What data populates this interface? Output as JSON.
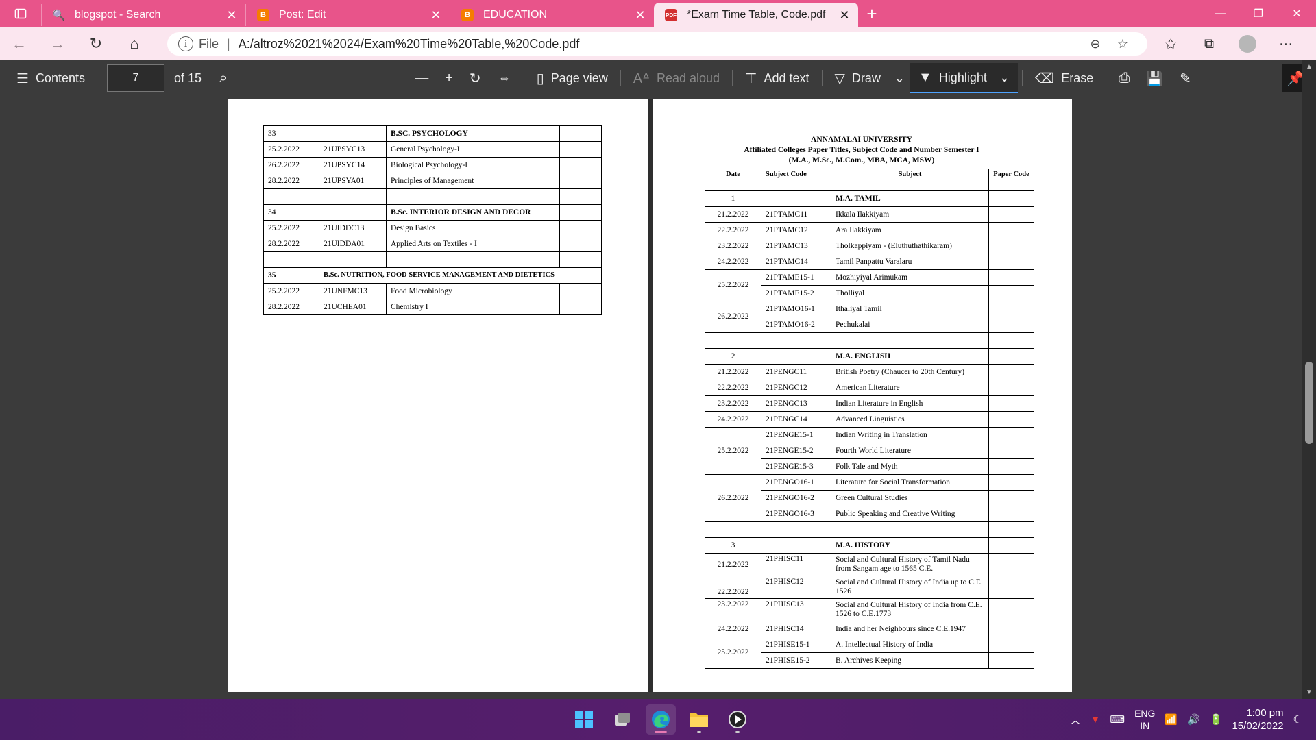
{
  "browser": {
    "tabs": [
      {
        "title": "blogspot - Search",
        "favicon": "search-icon",
        "active": false
      },
      {
        "title": "Post: Edit",
        "favicon": "blogger-icon",
        "active": false
      },
      {
        "title": "EDUCATION",
        "favicon": "blogger-icon",
        "active": false
      },
      {
        "title": "*Exam Time Table, Code.pdf",
        "favicon": "pdf-icon",
        "active": true
      }
    ],
    "address": {
      "scheme": "File",
      "url": "A:/altroz%2021%2024/Exam%20Time%20Table,%20Code.pdf"
    }
  },
  "pdf_toolbar": {
    "contents": "Contents",
    "page_current": "7",
    "page_total": "of 15",
    "page_view": "Page view",
    "read_aloud": "Read aloud",
    "add_text": "Add text",
    "draw": "Draw",
    "highlight": "Highlight",
    "erase": "Erase"
  },
  "left_page": {
    "rows": [
      {
        "num": "33",
        "title": "B.SC. PSYCHOLOGY"
      },
      {
        "date": "25.2.2022",
        "code": "21UPSYC13",
        "subject": "General Psychology-I"
      },
      {
        "date": "26.2.2022",
        "code": "21UPSYC14",
        "subject": "Biological Psychology-I"
      },
      {
        "date": "28.2.2022",
        "code": "21UPSYA01",
        "subject": "Principles of  Management"
      },
      {
        "num": "34",
        "title": "B.Sc.  INTERIOR DESIGN AND DECOR"
      },
      {
        "date": "25.2.2022",
        "code": "21UIDDC13",
        "subject": "Design Basics"
      },
      {
        "date": "28.2.2022",
        "code": "21UIDDA01",
        "subject": "Applied Arts on Textiles - I"
      },
      {
        "num": "35",
        "title": "B.Sc. NUTRITION, FOOD SERVICE MANAGEMENT AND DIETETICS"
      },
      {
        "date": "25.2.2022",
        "code": "21UNFMC13",
        "subject": "Food Microbiology"
      },
      {
        "date": "28.2.2022",
        "code": "21UCHEA01",
        "subject": "Chemistry I"
      }
    ]
  },
  "right_page": {
    "heading_1": "ANNAMALAI UNIVERSITY",
    "heading_2": "Affiliated Colleges Paper Titles, Subject Code  and Number Semester  I",
    "heading_3": "(M.A., M.Sc., M.Com., MBA, MCA, MSW)",
    "columns": [
      "Date",
      "Subject Code",
      "Subject",
      "Paper Code"
    ],
    "tamil": {
      "num": "1",
      "title": "M.A. TAMIL",
      "rows": [
        {
          "date": "21.2.2022",
          "code": "21PTAMC11",
          "subject": "Ikkala Ilakkiyam"
        },
        {
          "date": "22.2.2022",
          "code": "21PTAMC12",
          "subject": "Ara Ilakkiyam"
        },
        {
          "date": "23.2.2022",
          "code": "21PTAMC13",
          "subject": "Tholkappiyam - (Eluthuthathikaram)"
        },
        {
          "date": "24.2.2022",
          "code": "21PTAMC14",
          "subject": "Tamil Panpattu Varalaru"
        }
      ],
      "group_25": {
        "date": "25.2.2022",
        "items": [
          {
            "code": "21PTAME15-1",
            "subject": "Mozhiyiyal Arimukam"
          },
          {
            "code": "21PTAME15-2",
            "subject": "Tholliyal"
          }
        ]
      },
      "group_26": {
        "date": "26.2.2022",
        "items": [
          {
            "code": "21PTAMO16-1",
            "subject": "Ithaliyal Tamil"
          },
          {
            "code": "21PTAMO16-2",
            "subject": "Pechukalai"
          }
        ]
      }
    },
    "english": {
      "num": "2",
      "title": "M.A. ENGLISH",
      "rows": [
        {
          "date": "21.2.2022",
          "code": "21PENGC11",
          "subject": "British Poetry (Chaucer to 20th Century)"
        },
        {
          "date": "22.2.2022",
          "code": "21PENGC12",
          "subject": "American Literature"
        },
        {
          "date": "23.2.2022",
          "code": "21PENGC13",
          "subject": "Indian Literature in English"
        },
        {
          "date": "24.2.2022",
          "code": "21PENGC14",
          "subject": "Advanced Linguistics"
        }
      ],
      "group_25": {
        "date": "25.2.2022",
        "items": [
          {
            "code": "21PENGE15-1",
            "subject": "Indian Writing in Translation"
          },
          {
            "code": "21PENGE15-2",
            "subject": "Fourth World Literature"
          },
          {
            "code": "21PENGE15-3",
            "subject": "Folk Tale and Myth"
          }
        ]
      },
      "group_26": {
        "date": "26.2.2022",
        "items": [
          {
            "code": "21PENGO16-1",
            "subject": "Literature for Social Transformation"
          },
          {
            "code": "21PENGO16-2",
            "subject": "Green Cultural Studies"
          },
          {
            "code": "21PENGO16-3",
            "subject": "Public Speaking and Creative Writing"
          }
        ]
      }
    },
    "history": {
      "num": "3",
      "title": "M.A. HISTORY",
      "rows": [
        {
          "date": "21.2.2022",
          "code": "21PHISC11",
          "subject": "Social and Cultural History of Tamil Nadu from Sangam age to 1565 C.E."
        },
        {
          "date": "22.2.2022",
          "code": "21PHISC12",
          "subject": "Social and Cultural History of India up to C.E 1526"
        },
        {
          "date": "23.2.2022",
          "code": "21PHISC13",
          "subject": "Social and Cultural History of India from C.E. 1526 to C.E.1773"
        },
        {
          "date": "24.2.2022",
          "code": "21PHISC14",
          "subject": "India and her Neighbours since C.E.1947"
        }
      ],
      "group_25": {
        "date": "25.2.2022",
        "items": [
          {
            "code": "21PHISE15-1",
            "subject": "A. Intellectual History of India"
          },
          {
            "code": "21PHISE15-2",
            "subject": "B. Archives Keeping"
          }
        ]
      }
    }
  },
  "taskbar": {
    "lang_1": "ENG",
    "lang_2": "IN",
    "time": "1:00 pm",
    "date": "15/02/2022"
  },
  "colors": {
    "tab_strip": "#e8548a",
    "address_bar": "#fbe6ef",
    "toolbar": "#3b3b3b",
    "taskbar": "#561e6c"
  }
}
